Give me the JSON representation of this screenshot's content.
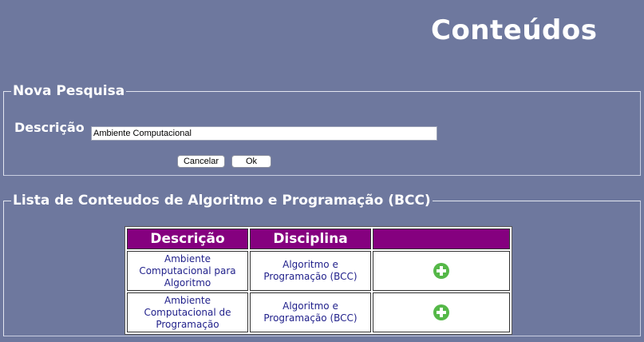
{
  "page": {
    "title": "Conteúdos"
  },
  "search": {
    "legend": "Nova Pesquisa",
    "description_label": "Descrição",
    "description_value": "Ambiente Computacional",
    "cancel_label": "Cancelar",
    "ok_label": "Ok"
  },
  "list": {
    "legend": "Lista de Conteudos de Algoritmo e Programação (BCC)",
    "headers": [
      "Descrição",
      "Disciplina",
      ""
    ],
    "rows": [
      {
        "descricao": "Ambiente Computacional para Algoritmo",
        "disciplina": "Algoritmo e Programação (BCC)",
        "action_icon": "add-icon"
      },
      {
        "descricao": "Ambiente Computacional de Programação",
        "disciplina": "Algoritmo e Programação (BCC)",
        "action_icon": "add-icon"
      }
    ]
  },
  "colors": {
    "background": "#6e789e",
    "header_background": "#85007f",
    "add_icon": "#55b848",
    "cell_text": "#1f1f8a"
  }
}
